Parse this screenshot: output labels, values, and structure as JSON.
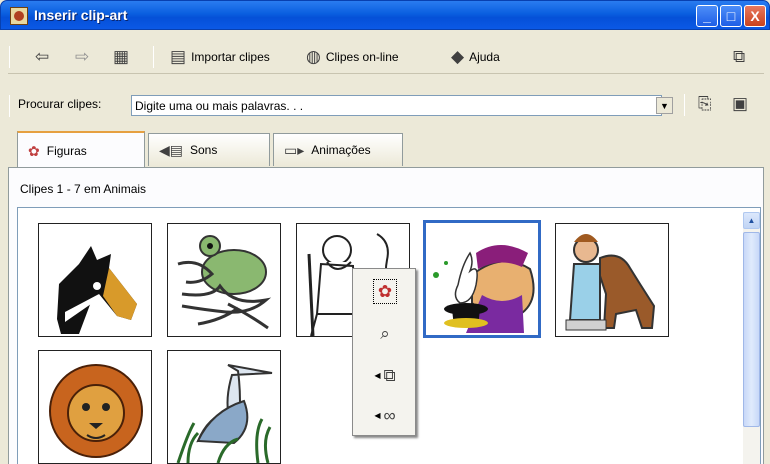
{
  "window": {
    "title": "Inserir clip-art",
    "min": "_",
    "max": "□",
    "close": "X"
  },
  "toolbar": {
    "back_icon": "back-arrow-icon",
    "forward_icon": "forward-arrow-icon",
    "import_label": "Importar clipes",
    "online_label": "Clipes on-line",
    "help_label": "Ajuda"
  },
  "search": {
    "label": "Procurar clipes:",
    "value": "Digite uma ou mais palavras. . ."
  },
  "tabs": [
    {
      "label": "Figuras",
      "icon": "pictures-icon"
    },
    {
      "label": "Sons",
      "icon": "speaker-icon"
    },
    {
      "label": "Animações",
      "icon": "camera-icon"
    }
  ],
  "breadcrumb": "Clipes 1 - 7 em Animais",
  "clips": [
    {
      "name": "horse"
    },
    {
      "name": "frog"
    },
    {
      "name": "old-man"
    },
    {
      "name": "magician"
    },
    {
      "name": "girl-with-dog"
    },
    {
      "name": "lion"
    },
    {
      "name": "heron"
    }
  ],
  "colors": {
    "title_bar": "#0a5fe0",
    "selection": "#316ac5",
    "window_bg": "#ece9d8"
  }
}
